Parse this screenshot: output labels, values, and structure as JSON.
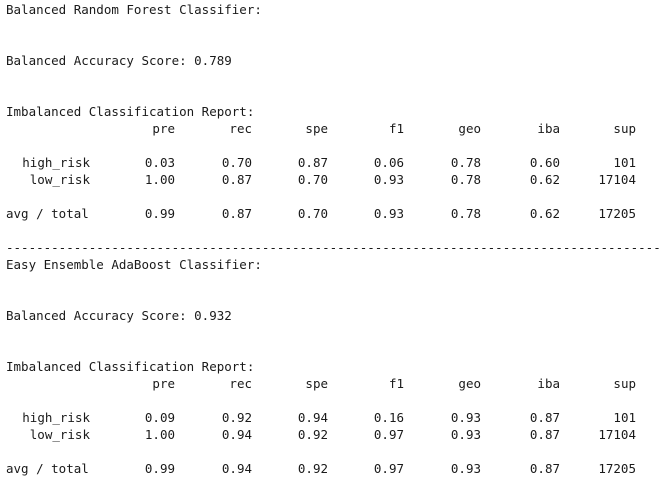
{
  "report1": {
    "classifier_title": "Balanced Random Forest Classifier:",
    "accuracy_line": "Balanced Accuracy Score: 0.789",
    "report_title": "Imbalanced Classification Report:",
    "headers": [
      "pre",
      "rec",
      "spe",
      "f1",
      "geo",
      "iba",
      "sup"
    ],
    "rows": [
      {
        "label": "high_risk",
        "values": [
          "0.03",
          "0.70",
          "0.87",
          "0.06",
          "0.78",
          "0.60",
          "101"
        ]
      },
      {
        "label": "low_risk",
        "values": [
          "1.00",
          "0.87",
          "0.70",
          "0.93",
          "0.78",
          "0.62",
          "17104"
        ]
      }
    ],
    "total": {
      "label": "avg / total",
      "values": [
        "0.99",
        "0.87",
        "0.70",
        "0.93",
        "0.78",
        "0.62",
        "17205"
      ]
    }
  },
  "divider": "--------------------------------------------------------------------------------------------------------------",
  "report2": {
    "classifier_title": "Easy Ensemble AdaBoost Classifier:",
    "accuracy_line": "Balanced Accuracy Score: 0.932",
    "report_title": "Imbalanced Classification Report:",
    "headers": [
      "pre",
      "rec",
      "spe",
      "f1",
      "geo",
      "iba",
      "sup"
    ],
    "rows": [
      {
        "label": "high_risk",
        "values": [
          "0.09",
          "0.92",
          "0.94",
          "0.16",
          "0.93",
          "0.87",
          "101"
        ]
      },
      {
        "label": "low_risk",
        "values": [
          "1.00",
          "0.94",
          "0.92",
          "0.97",
          "0.93",
          "0.87",
          "17104"
        ]
      }
    ],
    "total": {
      "label": "avg / total",
      "values": [
        "0.99",
        "0.94",
        "0.92",
        "0.97",
        "0.93",
        "0.87",
        "17205"
      ]
    }
  }
}
